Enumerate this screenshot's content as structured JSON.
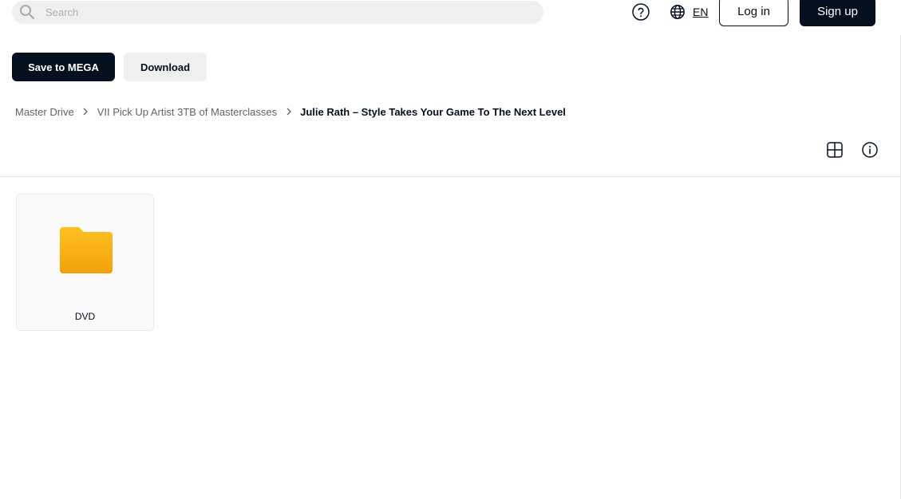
{
  "search": {
    "placeholder": "Search",
    "value": ""
  },
  "header": {
    "language": "EN",
    "login_label": "Log in",
    "signup_label": "Sign up"
  },
  "actions": {
    "save_label": "Save to MEGA",
    "download_label": "Download"
  },
  "breadcrumb": {
    "items": [
      "Master Drive",
      "VII Pick Up Artist 3TB of Masterclasses",
      "Julie Rath – Style Takes Your Game To The Next Level"
    ]
  },
  "files": [
    {
      "name": "DVD",
      "type": "folder",
      "icon": "folder-icon"
    }
  ],
  "colors": {
    "primary_dark": "#04101e",
    "button_light": "#efefef",
    "folder_yellow": "#fbb615",
    "folder_orange": "#f59d0e"
  },
  "icons": {
    "search": "search-icon",
    "help": "help-icon",
    "language": "globe-icon",
    "separator": "chevron-right-icon",
    "view": "grid-view-icon",
    "info": "info-icon"
  }
}
